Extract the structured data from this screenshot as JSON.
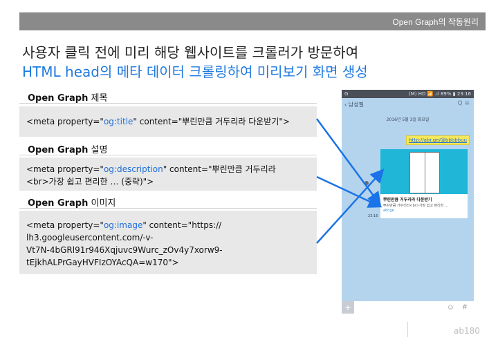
{
  "topbar": {
    "title": "Open Graph의 작동원리"
  },
  "headline": {
    "line1": "사용자 클릭 전에 미리 해당 웹사이트를 크롤러가 방문하여",
    "line2": "HTML head의 메타 데이터 크롤링하여 미리보기 화면 생성"
  },
  "sections": [
    {
      "title_bold": "Open Graph",
      "title_rest": " 제목",
      "code_pre": "<meta property=\"",
      "code_prop": "og:title",
      "code_post": "\" content=\"뿌린만큼 거두리라 다운받기\">"
    },
    {
      "title_bold": "Open Graph",
      "title_rest": " 설명",
      "code_pre": "<meta property=\"",
      "code_prop": "og:description",
      "code_post": "\" content=\"뿌린만큼 거두리라",
      "code_line2": "<br>가장 쉽고 편리한 … (중략)\">"
    },
    {
      "title_bold": "Open Graph",
      "title_rest": " 이미지",
      "code_pre": "<meta property=\"",
      "code_prop": "og:image",
      "code_post": "\" content=\"https://",
      "code_line2": "lh3.googleusercontent.com/-v-",
      "code_line3": "Vt7N-4bGRl91r946Xqjuvc9Wurc_zOv4y7xorw9-",
      "code_line4": "tEjkhALPrGayHVFIzOYAcQA=w170\">"
    }
  ],
  "phone": {
    "status_left": "G",
    "status_right": "(M) HD 📶 .ıl 89% ▮ 23:16",
    "header_name": "‹ 남성필",
    "header_icons": "Q  ≡",
    "date": "2016년 5월 3일 화요일",
    "link": "http://abr.ge/@bbbbbuu",
    "card_title": "뿌린만큼 거두리라 다운받기",
    "card_desc": "뿌린만큼 거두리라<br>가장 쉽고 편리한 ...",
    "card_site": "abr.ge",
    "time": "23:16",
    "plus": "+",
    "emoji": "☺",
    "hash": "#"
  },
  "footer": {
    "brand": "ab180"
  },
  "colors": {
    "accent": "#1f7ae0",
    "topbar": "#8a8a8a",
    "arrow": "#1a73e8"
  }
}
